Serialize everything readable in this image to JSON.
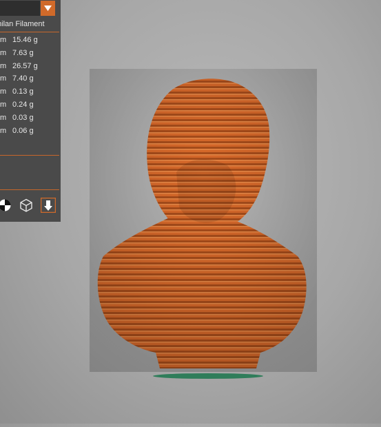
{
  "panel": {
    "header": "milan Filament",
    "rows": [
      {
        "unit": "m",
        "weight": "15.46 g"
      },
      {
        "unit": "m",
        "weight": "7.63 g"
      },
      {
        "unit": "m",
        "weight": "26.57 g"
      },
      {
        "unit": "m",
        "weight": "7.40 g"
      },
      {
        "unit": "m",
        "weight": "0.13 g"
      },
      {
        "unit": "m",
        "weight": "0.24 g"
      },
      {
        "unit": "m",
        "weight": "0.03 g"
      },
      {
        "unit": "m",
        "weight": "0.06 g"
      }
    ]
  },
  "toolbar": {
    "icons": [
      "color-mode-icon",
      "wireframe-cube-icon",
      "export-icon"
    ]
  },
  "colors": {
    "accent": "#d06a2a",
    "model": "#d6692b",
    "base": "#2f7d5a"
  }
}
